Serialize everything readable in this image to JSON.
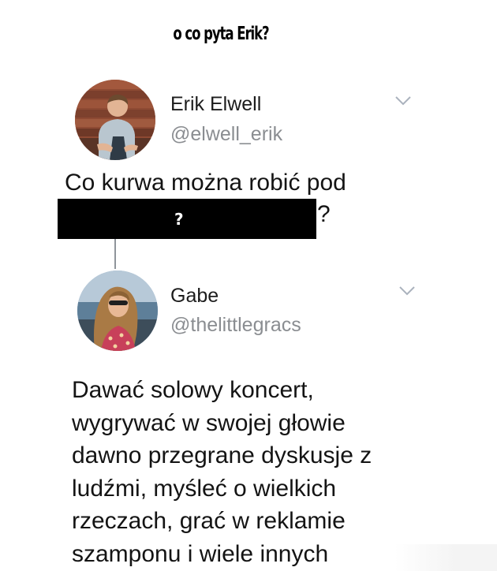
{
  "meme": {
    "title": "o co pyta Erik?"
  },
  "tweet": {
    "display_name": "Erik Elwell",
    "handle": "@elwell_erik",
    "text": "Co kurwa można robić pod",
    "trailing_mark": "?",
    "redacted_label": "?",
    "menu_icon": "chevron-down-icon",
    "avatar_icon": "avatar-photo"
  },
  "reply": {
    "display_name": "Gabe",
    "handle": "@thelittlegracs",
    "lines": [
      "Dawać solowy koncert,",
      "wygrywać w swojej głowie",
      "dawno przegrane dyskusje z",
      "ludźmi, myśleć o wielkich",
      "rzeczach, grać w reklamie",
      "szamponu i wiele innych"
    ],
    "menu_icon": "chevron-down-icon",
    "avatar_icon": "avatar-photo"
  },
  "colors": {
    "text": "#141414",
    "handle": "#8a8d91",
    "redaction": "#000000",
    "thread_line": "#8f959b",
    "chevron": "#aab2bd"
  }
}
